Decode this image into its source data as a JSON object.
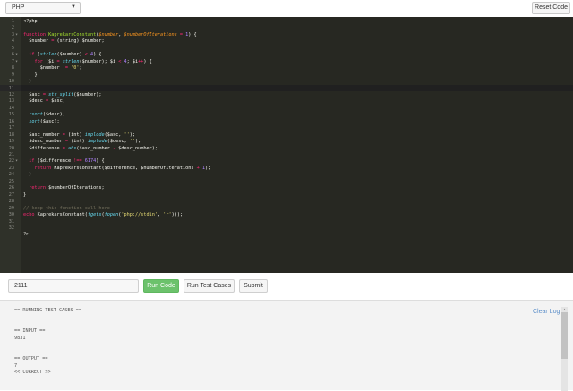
{
  "toolbar": {
    "language": "PHP",
    "reset_label": "Reset Code"
  },
  "editor": {
    "lines": [
      {
        "n": "1",
        "fold": "",
        "segs": [
          [
            "v",
            "<?php"
          ]
        ]
      },
      {
        "n": "2",
        "fold": "",
        "segs": []
      },
      {
        "n": "3",
        "fold": "▾",
        "segs": [
          [
            "k",
            "function "
          ],
          [
            "f",
            "KaprekarsConstant"
          ],
          [
            "v",
            "("
          ],
          [
            "p",
            "$number"
          ],
          [
            "v",
            ", "
          ],
          [
            "p",
            "$numberOfIterations"
          ],
          [
            "v",
            " "
          ],
          [
            "k",
            "="
          ],
          [
            "v",
            " "
          ],
          [
            "n",
            "1"
          ],
          [
            "v",
            ") {"
          ]
        ]
      },
      {
        "n": "4",
        "fold": "",
        "segs": [
          [
            "v",
            "  $number "
          ],
          [
            "k",
            "="
          ],
          [
            "v",
            " (string) $number;"
          ]
        ]
      },
      {
        "n": "5",
        "fold": "",
        "segs": []
      },
      {
        "n": "6",
        "fold": "▾",
        "segs": [
          [
            "v",
            "  "
          ],
          [
            "k",
            "if"
          ],
          [
            "v",
            " ("
          ],
          [
            "fn",
            "strlen"
          ],
          [
            "v",
            "($number) "
          ],
          [
            "k",
            "<"
          ],
          [
            "v",
            " "
          ],
          [
            "n",
            "4"
          ],
          [
            "v",
            ") {"
          ]
        ]
      },
      {
        "n": "7",
        "fold": "▾",
        "segs": [
          [
            "v",
            "    "
          ],
          [
            "k",
            "for"
          ],
          [
            "v",
            " ($i "
          ],
          [
            "k",
            "="
          ],
          [
            "v",
            " "
          ],
          [
            "fn",
            "strlen"
          ],
          [
            "v",
            "($number); $i "
          ],
          [
            "k",
            "<"
          ],
          [
            "v",
            " "
          ],
          [
            "n",
            "4"
          ],
          [
            "v",
            "; $i"
          ],
          [
            "k",
            "++"
          ],
          [
            "v",
            ") {"
          ]
        ]
      },
      {
        "n": "8",
        "fold": "",
        "segs": [
          [
            "v",
            "      $number "
          ],
          [
            "k",
            ".="
          ],
          [
            "v",
            " "
          ],
          [
            "s",
            "'0'"
          ],
          [
            "v",
            ";"
          ]
        ]
      },
      {
        "n": "9",
        "fold": "",
        "segs": [
          [
            "v",
            "    }"
          ]
        ]
      },
      {
        "n": "10",
        "fold": "",
        "segs": [
          [
            "v",
            "  }"
          ]
        ]
      },
      {
        "n": "11",
        "fold": "",
        "segs": []
      },
      {
        "n": "12",
        "fold": "",
        "segs": [
          [
            "v",
            "  $asc "
          ],
          [
            "k",
            "="
          ],
          [
            "v",
            " "
          ],
          [
            "fn",
            "str_split"
          ],
          [
            "v",
            "($number);"
          ]
        ]
      },
      {
        "n": "13",
        "fold": "",
        "segs": [
          [
            "v",
            "  $desc "
          ],
          [
            "k",
            "="
          ],
          [
            "v",
            " $asc;"
          ]
        ]
      },
      {
        "n": "14",
        "fold": "",
        "segs": []
      },
      {
        "n": "15",
        "fold": "",
        "segs": [
          [
            "v",
            "  "
          ],
          [
            "fn",
            "rsort"
          ],
          [
            "v",
            "($desc);"
          ]
        ]
      },
      {
        "n": "16",
        "fold": "",
        "segs": [
          [
            "v",
            "  "
          ],
          [
            "fn",
            "sort"
          ],
          [
            "v",
            "($asc);"
          ]
        ]
      },
      {
        "n": "17",
        "fold": "",
        "segs": []
      },
      {
        "n": "18",
        "fold": "",
        "segs": [
          [
            "v",
            "  $asc_number "
          ],
          [
            "k",
            "="
          ],
          [
            "v",
            " (int) "
          ],
          [
            "fn",
            "implode"
          ],
          [
            "v",
            "($asc, "
          ],
          [
            "s",
            "''"
          ],
          [
            "v",
            ");"
          ]
        ]
      },
      {
        "n": "19",
        "fold": "",
        "segs": [
          [
            "v",
            "  $desc_number "
          ],
          [
            "k",
            "="
          ],
          [
            "v",
            " (int) "
          ],
          [
            "fn",
            "implode"
          ],
          [
            "v",
            "($desc, "
          ],
          [
            "s",
            "''"
          ],
          [
            "v",
            ");"
          ]
        ]
      },
      {
        "n": "20",
        "fold": "",
        "segs": [
          [
            "v",
            "  $difference "
          ],
          [
            "k",
            "="
          ],
          [
            "v",
            " "
          ],
          [
            "fn",
            "abs"
          ],
          [
            "v",
            "($asc_number "
          ],
          [
            "k",
            "-"
          ],
          [
            "v",
            " $desc_number);"
          ]
        ]
      },
      {
        "n": "21",
        "fold": "",
        "segs": []
      },
      {
        "n": "22",
        "fold": "▾",
        "segs": [
          [
            "v",
            "  "
          ],
          [
            "k",
            "if"
          ],
          [
            "v",
            " ($difference "
          ],
          [
            "k",
            "!=="
          ],
          [
            "v",
            " "
          ],
          [
            "n",
            "6174"
          ],
          [
            "v",
            ") {"
          ]
        ]
      },
      {
        "n": "23",
        "fold": "",
        "segs": [
          [
            "v",
            "    "
          ],
          [
            "k",
            "return"
          ],
          [
            "v",
            " KaprekarsConstant($difference, $numberOfIterations "
          ],
          [
            "k",
            "+"
          ],
          [
            "v",
            " "
          ],
          [
            "n",
            "1"
          ],
          [
            "v",
            ");"
          ]
        ]
      },
      {
        "n": "24",
        "fold": "",
        "segs": [
          [
            "v",
            "  }"
          ]
        ]
      },
      {
        "n": "25",
        "fold": "",
        "segs": []
      },
      {
        "n": "26",
        "fold": "",
        "segs": [
          [
            "v",
            "  "
          ],
          [
            "k",
            "return"
          ],
          [
            "v",
            " $numberOfIterations;"
          ]
        ]
      },
      {
        "n": "27",
        "fold": "",
        "segs": [
          [
            "v",
            "}"
          ]
        ]
      },
      {
        "n": "28",
        "fold": "",
        "segs": []
      },
      {
        "n": "29",
        "fold": "",
        "segs": [
          [
            "c",
            "// keep this function call here"
          ]
        ]
      },
      {
        "n": "30",
        "fold": "",
        "segs": [
          [
            "k",
            "echo"
          ],
          [
            "v",
            " KaprekarsConstant("
          ],
          [
            "fn",
            "fgets"
          ],
          [
            "v",
            "("
          ],
          [
            "fn",
            "fopen"
          ],
          [
            "v",
            "("
          ],
          [
            "s",
            "'php://stdin'"
          ],
          [
            "v",
            ", "
          ],
          [
            "s",
            "'r'"
          ],
          [
            "v",
            ")));"
          ]
        ]
      },
      {
        "n": "31",
        "fold": "",
        "segs": []
      },
      {
        "n": "32",
        "fold": "",
        "segs": []
      },
      {
        "n": "",
        "fold": "",
        "segs": [
          [
            "v",
            "?>"
          ]
        ]
      }
    ]
  },
  "controls": {
    "input_value": "2111",
    "run_label": "Run Code",
    "run_tests_label": "Run Test Cases",
    "submit_label": "Submit"
  },
  "console": {
    "clear_label": "Clear Log",
    "lines": [
      "== RUNNING TEST CASES ==",
      "",
      "",
      "== INPUT ==",
      "9831",
      "",
      "",
      "== OUTPUT ==",
      "7",
      "<< CORRECT >>"
    ]
  },
  "colors": {
    "editor_bg": "#272822",
    "run_button": "#6cc26c",
    "link": "#5b8ec9"
  }
}
